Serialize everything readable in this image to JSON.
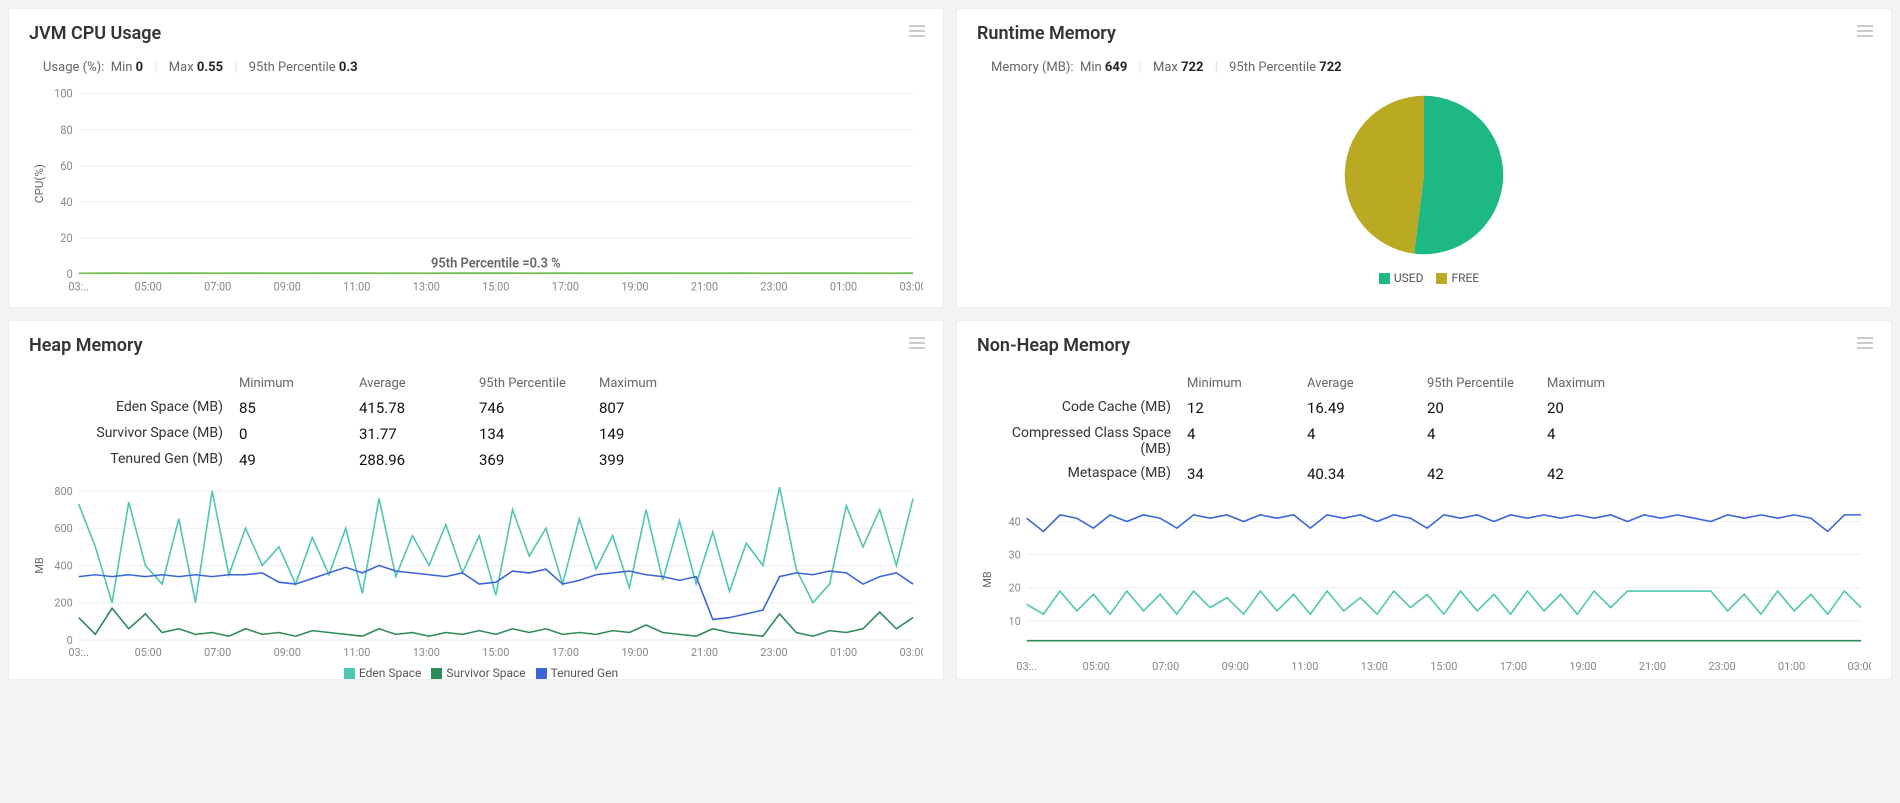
{
  "panels": {
    "cpu": {
      "title": "JVM CPU Usage",
      "stats_label": "Usage (%):",
      "stats": {
        "min_lbl": "Min",
        "min": "0",
        "max_lbl": "Max",
        "max": "0.55",
        "p95_lbl": "95th Percentile",
        "p95": "0.3"
      },
      "annotation": "95th Percentile =0.3 %"
    },
    "runtime": {
      "title": "Runtime Memory",
      "stats_label": "Memory (MB):",
      "stats": {
        "min_lbl": "Min",
        "min": "649",
        "max_lbl": "Max",
        "max": "722",
        "p95_lbl": "95th Percentile",
        "p95": "722"
      },
      "legend": {
        "used": "USED",
        "free": "FREE"
      }
    },
    "heap": {
      "title": "Heap Memory",
      "columns": [
        "Minimum",
        "Average",
        "95th Percentile",
        "Maximum"
      ],
      "rows": [
        {
          "label": "Eden Space (MB)",
          "v": [
            "85",
            "415.78",
            "746",
            "807"
          ]
        },
        {
          "label": "Survivor Space (MB)",
          "v": [
            "0",
            "31.77",
            "134",
            "149"
          ]
        },
        {
          "label": "Tenured Gen (MB)",
          "v": [
            "49",
            "288.96",
            "369",
            "399"
          ]
        }
      ],
      "legend": [
        "Eden Space",
        "Survivor Space",
        "Tenured Gen"
      ]
    },
    "nonheap": {
      "title": "Non-Heap Memory",
      "columns": [
        "Minimum",
        "Average",
        "95th Percentile",
        "Maximum"
      ],
      "rows": [
        {
          "label": "Code Cache (MB)",
          "v": [
            "12",
            "16.49",
            "20",
            "20"
          ]
        },
        {
          "label": "Compressed Class Space (MB)",
          "v": [
            "4",
            "4",
            "4",
            "4"
          ]
        },
        {
          "label": "Metaspace (MB)",
          "v": [
            "34",
            "40.34",
            "42",
            "42"
          ]
        }
      ]
    }
  },
  "colors": {
    "eden": "#4fc6b0",
    "survivor": "#2d8a58",
    "tenured": "#3a66d6",
    "cpu": "#6fbf4b",
    "used": "#1eb884",
    "free": "#b9a923",
    "codecache": "#4fc6b0",
    "compressed": "#2d8a58",
    "metaspace": "#3a66d6"
  },
  "chart_data": [
    {
      "id": "jvm_cpu",
      "type": "line",
      "title": "JVM CPU Usage",
      "xlabel": "",
      "ylabel": "CPU(%)",
      "ylim": [
        0,
        100
      ],
      "yticks": [
        0,
        20,
        40,
        60,
        80,
        100
      ],
      "xticks": [
        "03:..",
        "05:00",
        "07:00",
        "09:00",
        "11:00",
        "13:00",
        "15:00",
        "17:00",
        "19:00",
        "21:00",
        "23:00",
        "01:00",
        "03:00"
      ],
      "series": [
        {
          "name": "Usage",
          "color": "#6fbf4b",
          "values": [
            0.2,
            0.3,
            0.25,
            0.3,
            0.28,
            0.3,
            0.25,
            0.3,
            0.3,
            0.25,
            0.28,
            0.3,
            0.3,
            0.28,
            0.3,
            0.25,
            0.3,
            0.3,
            0.25,
            0.3,
            0.28,
            0.3,
            0.3,
            0.25,
            0.3
          ]
        }
      ],
      "annotations": [
        {
          "text": "95th Percentile =0.3 %"
        }
      ]
    },
    {
      "id": "runtime_memory",
      "type": "pie",
      "title": "Runtime Memory",
      "series": [
        {
          "name": "USED",
          "value": 52,
          "color": "#1eb884"
        },
        {
          "name": "FREE",
          "value": 48,
          "color": "#b9a923"
        }
      ]
    },
    {
      "id": "heap_memory",
      "type": "line",
      "title": "Heap Memory",
      "ylabel": "MB",
      "ylim": [
        0,
        800
      ],
      "yticks": [
        0,
        200,
        400,
        600,
        800
      ],
      "xticks": [
        "03:..",
        "05:00",
        "07:00",
        "09:00",
        "11:00",
        "13:00",
        "15:00",
        "17:00",
        "19:00",
        "21:00",
        "23:00",
        "01:00",
        "03:00"
      ],
      "series": [
        {
          "name": "Eden Space",
          "color": "#4fc6b0",
          "values": [
            730,
            500,
            200,
            740,
            400,
            300,
            650,
            200,
            800,
            350,
            600,
            400,
            500,
            300,
            550,
            350,
            600,
            250,
            760,
            340,
            560,
            400,
            620,
            360,
            560,
            240,
            700,
            450,
            600,
            300,
            650,
            380,
            560,
            280,
            700,
            320,
            640,
            300,
            580,
            260,
            520,
            400,
            820,
            380,
            200,
            300,
            720,
            500,
            700,
            400,
            760
          ]
        },
        {
          "name": "Survivor Space",
          "color": "#2d8a58",
          "values": [
            120,
            30,
            170,
            60,
            140,
            40,
            60,
            30,
            40,
            20,
            60,
            30,
            40,
            20,
            50,
            40,
            30,
            20,
            60,
            30,
            40,
            20,
            40,
            30,
            50,
            30,
            60,
            40,
            60,
            30,
            40,
            30,
            50,
            40,
            80,
            40,
            30,
            20,
            60,
            40,
            30,
            20,
            140,
            40,
            20,
            50,
            40,
            60,
            150,
            60,
            120
          ]
        },
        {
          "name": "Tenured Gen",
          "color": "#3a66d6",
          "values": [
            340,
            350,
            340,
            350,
            340,
            350,
            340,
            350,
            340,
            350,
            350,
            360,
            310,
            300,
            330,
            360,
            390,
            360,
            400,
            370,
            360,
            350,
            340,
            360,
            300,
            310,
            370,
            360,
            380,
            300,
            320,
            350,
            360,
            370,
            350,
            340,
            320,
            340,
            110,
            120,
            140,
            160,
            340,
            360,
            350,
            370,
            360,
            300,
            340,
            360,
            300
          ]
        }
      ]
    },
    {
      "id": "nonheap_memory",
      "type": "line",
      "title": "Non-Heap Memory",
      "ylabel": "MB",
      "ylim": [
        0,
        45
      ],
      "yticks": [
        10,
        20,
        30,
        40
      ],
      "xticks": [
        "03:..",
        "05:00",
        "07:00",
        "09:00",
        "11:00",
        "13:00",
        "15:00",
        "17:00",
        "19:00",
        "21:00",
        "23:00",
        "01:00",
        "03:00"
      ],
      "series": [
        {
          "name": "Metaspace",
          "color": "#3a66d6",
          "values": [
            41,
            37,
            42,
            41,
            38,
            42,
            40,
            42,
            41,
            38,
            42,
            41,
            42,
            40,
            42,
            41,
            42,
            38,
            42,
            41,
            42,
            40,
            42,
            41,
            38,
            42,
            41,
            42,
            40,
            42,
            41,
            42,
            41,
            42,
            41,
            42,
            40,
            42,
            41,
            42,
            41,
            40,
            42,
            41,
            42,
            41,
            42,
            41,
            37,
            42,
            42
          ]
        },
        {
          "name": "Code Cache",
          "color": "#4fc6b0",
          "values": [
            15,
            12,
            19,
            13,
            18,
            12,
            19,
            13,
            18,
            12,
            19,
            14,
            17,
            12,
            19,
            13,
            18,
            12,
            19,
            13,
            17,
            12,
            19,
            14,
            18,
            12,
            19,
            13,
            18,
            12,
            19,
            13,
            18,
            12,
            19,
            14,
            19,
            19,
            19,
            19,
            19,
            19,
            13,
            18,
            12,
            19,
            13,
            18,
            12,
            19,
            14
          ]
        },
        {
          "name": "Compressed Class Space",
          "color": "#2d8a58",
          "values": [
            4,
            4,
            4,
            4,
            4,
            4,
            4,
            4,
            4,
            4,
            4,
            4,
            4,
            4,
            4,
            4,
            4,
            4,
            4,
            4,
            4,
            4,
            4,
            4,
            4,
            4,
            4,
            4,
            4,
            4,
            4,
            4,
            4,
            4,
            4,
            4,
            4,
            4,
            4,
            4,
            4,
            4,
            4,
            4,
            4,
            4,
            4,
            4,
            4,
            4,
            4
          ]
        }
      ]
    }
  ]
}
